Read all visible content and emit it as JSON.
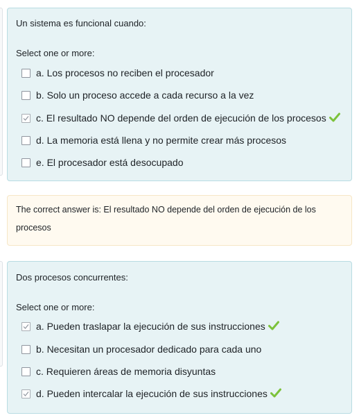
{
  "question1": {
    "text": "Un sistema es funcional cuando:",
    "prompt": "Select one or more:",
    "options": [
      {
        "label": "a. Los procesos no reciben el procesador",
        "checked": false,
        "correct": false
      },
      {
        "label": "b. Solo un proceso accede a cada recurso a la vez",
        "checked": false,
        "correct": false
      },
      {
        "label": "c. El resultado NO depende del orden de ejecución de los procesos",
        "checked": true,
        "correct": true
      },
      {
        "label": "d. La memoria está llena y no permite crear más procesos",
        "checked": false,
        "correct": false
      },
      {
        "label": "e. El procesador está desocupado",
        "checked": false,
        "correct": false
      }
    ],
    "feedback": "The correct answer is: El resultado NO depende del orden de ejecución de los procesos"
  },
  "question2": {
    "text": "Dos procesos concurrentes:",
    "prompt": "Select one or more:",
    "options": [
      {
        "label": "a. Pueden traslapar la ejecución de sus instrucciones",
        "checked": true,
        "correct": true
      },
      {
        "label": "b. Necesitan un procesador dedicado para cada uno",
        "checked": false,
        "correct": false
      },
      {
        "label": "c. Requieren áreas de memoria disyuntas",
        "checked": false,
        "correct": false
      },
      {
        "label": "d. Pueden intercalar la ejecución de sus instrucciones",
        "checked": true,
        "correct": true
      }
    ]
  },
  "icons": {
    "correct_mark": "check-icon",
    "correct_color": "#7cc23b"
  }
}
